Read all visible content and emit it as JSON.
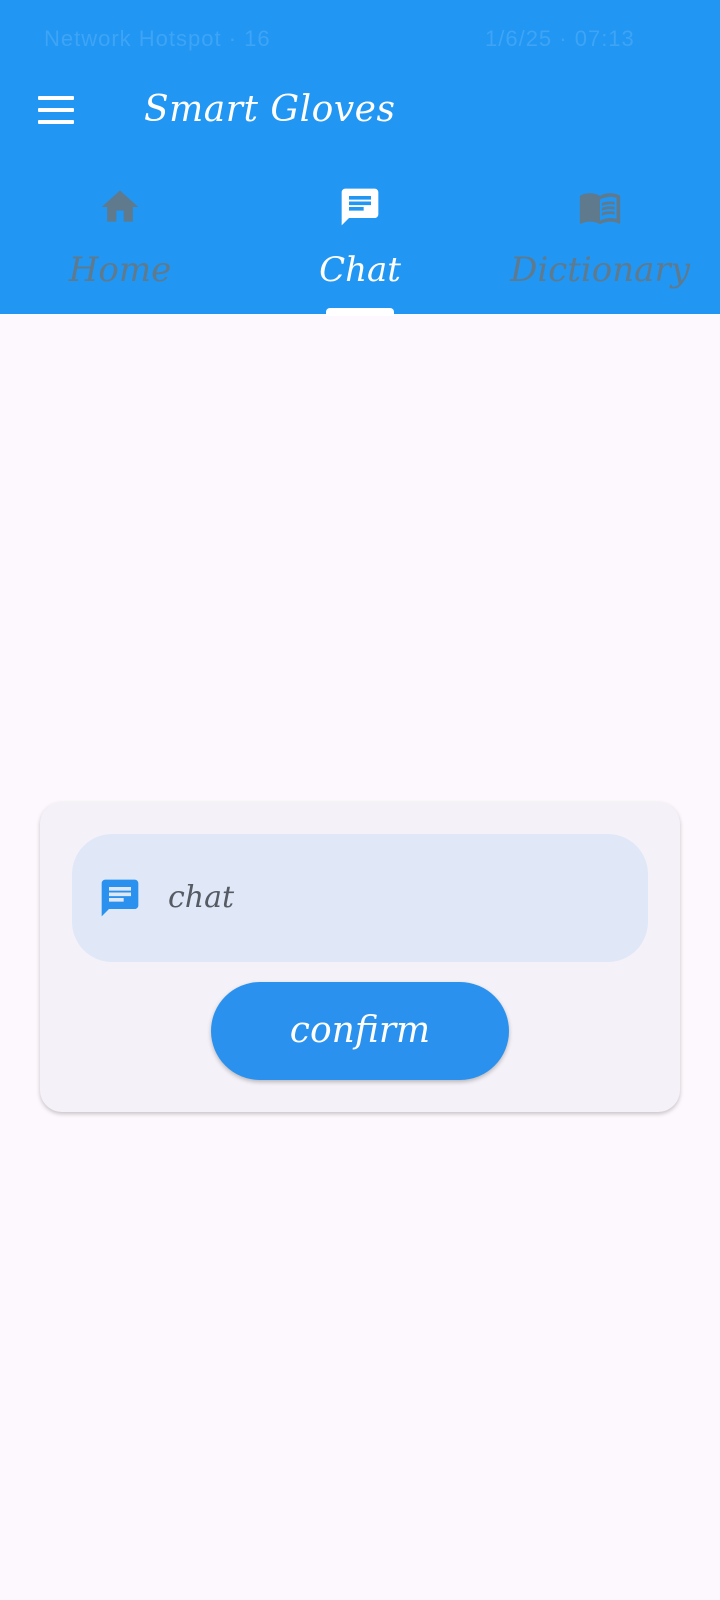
{
  "status_bar": {
    "left_text": "Network Hotspot · 16",
    "right_text": "1/6/25 · 07:13"
  },
  "app_bar": {
    "title": "Smart Gloves",
    "menu_icon": "hamburger-menu-icon",
    "background_color": "#2196f3"
  },
  "tabs": [
    {
      "label": "Home",
      "icon": "home-icon",
      "active": false
    },
    {
      "label": "Chat",
      "icon": "chat-icon",
      "active": true
    },
    {
      "label": "Dictionary",
      "icon": "book-icon",
      "active": false
    }
  ],
  "chat_form": {
    "input_icon": "chat-icon",
    "input_placeholder": "chat",
    "confirm_label": "confirm",
    "accent_color": "#2a92ee"
  }
}
